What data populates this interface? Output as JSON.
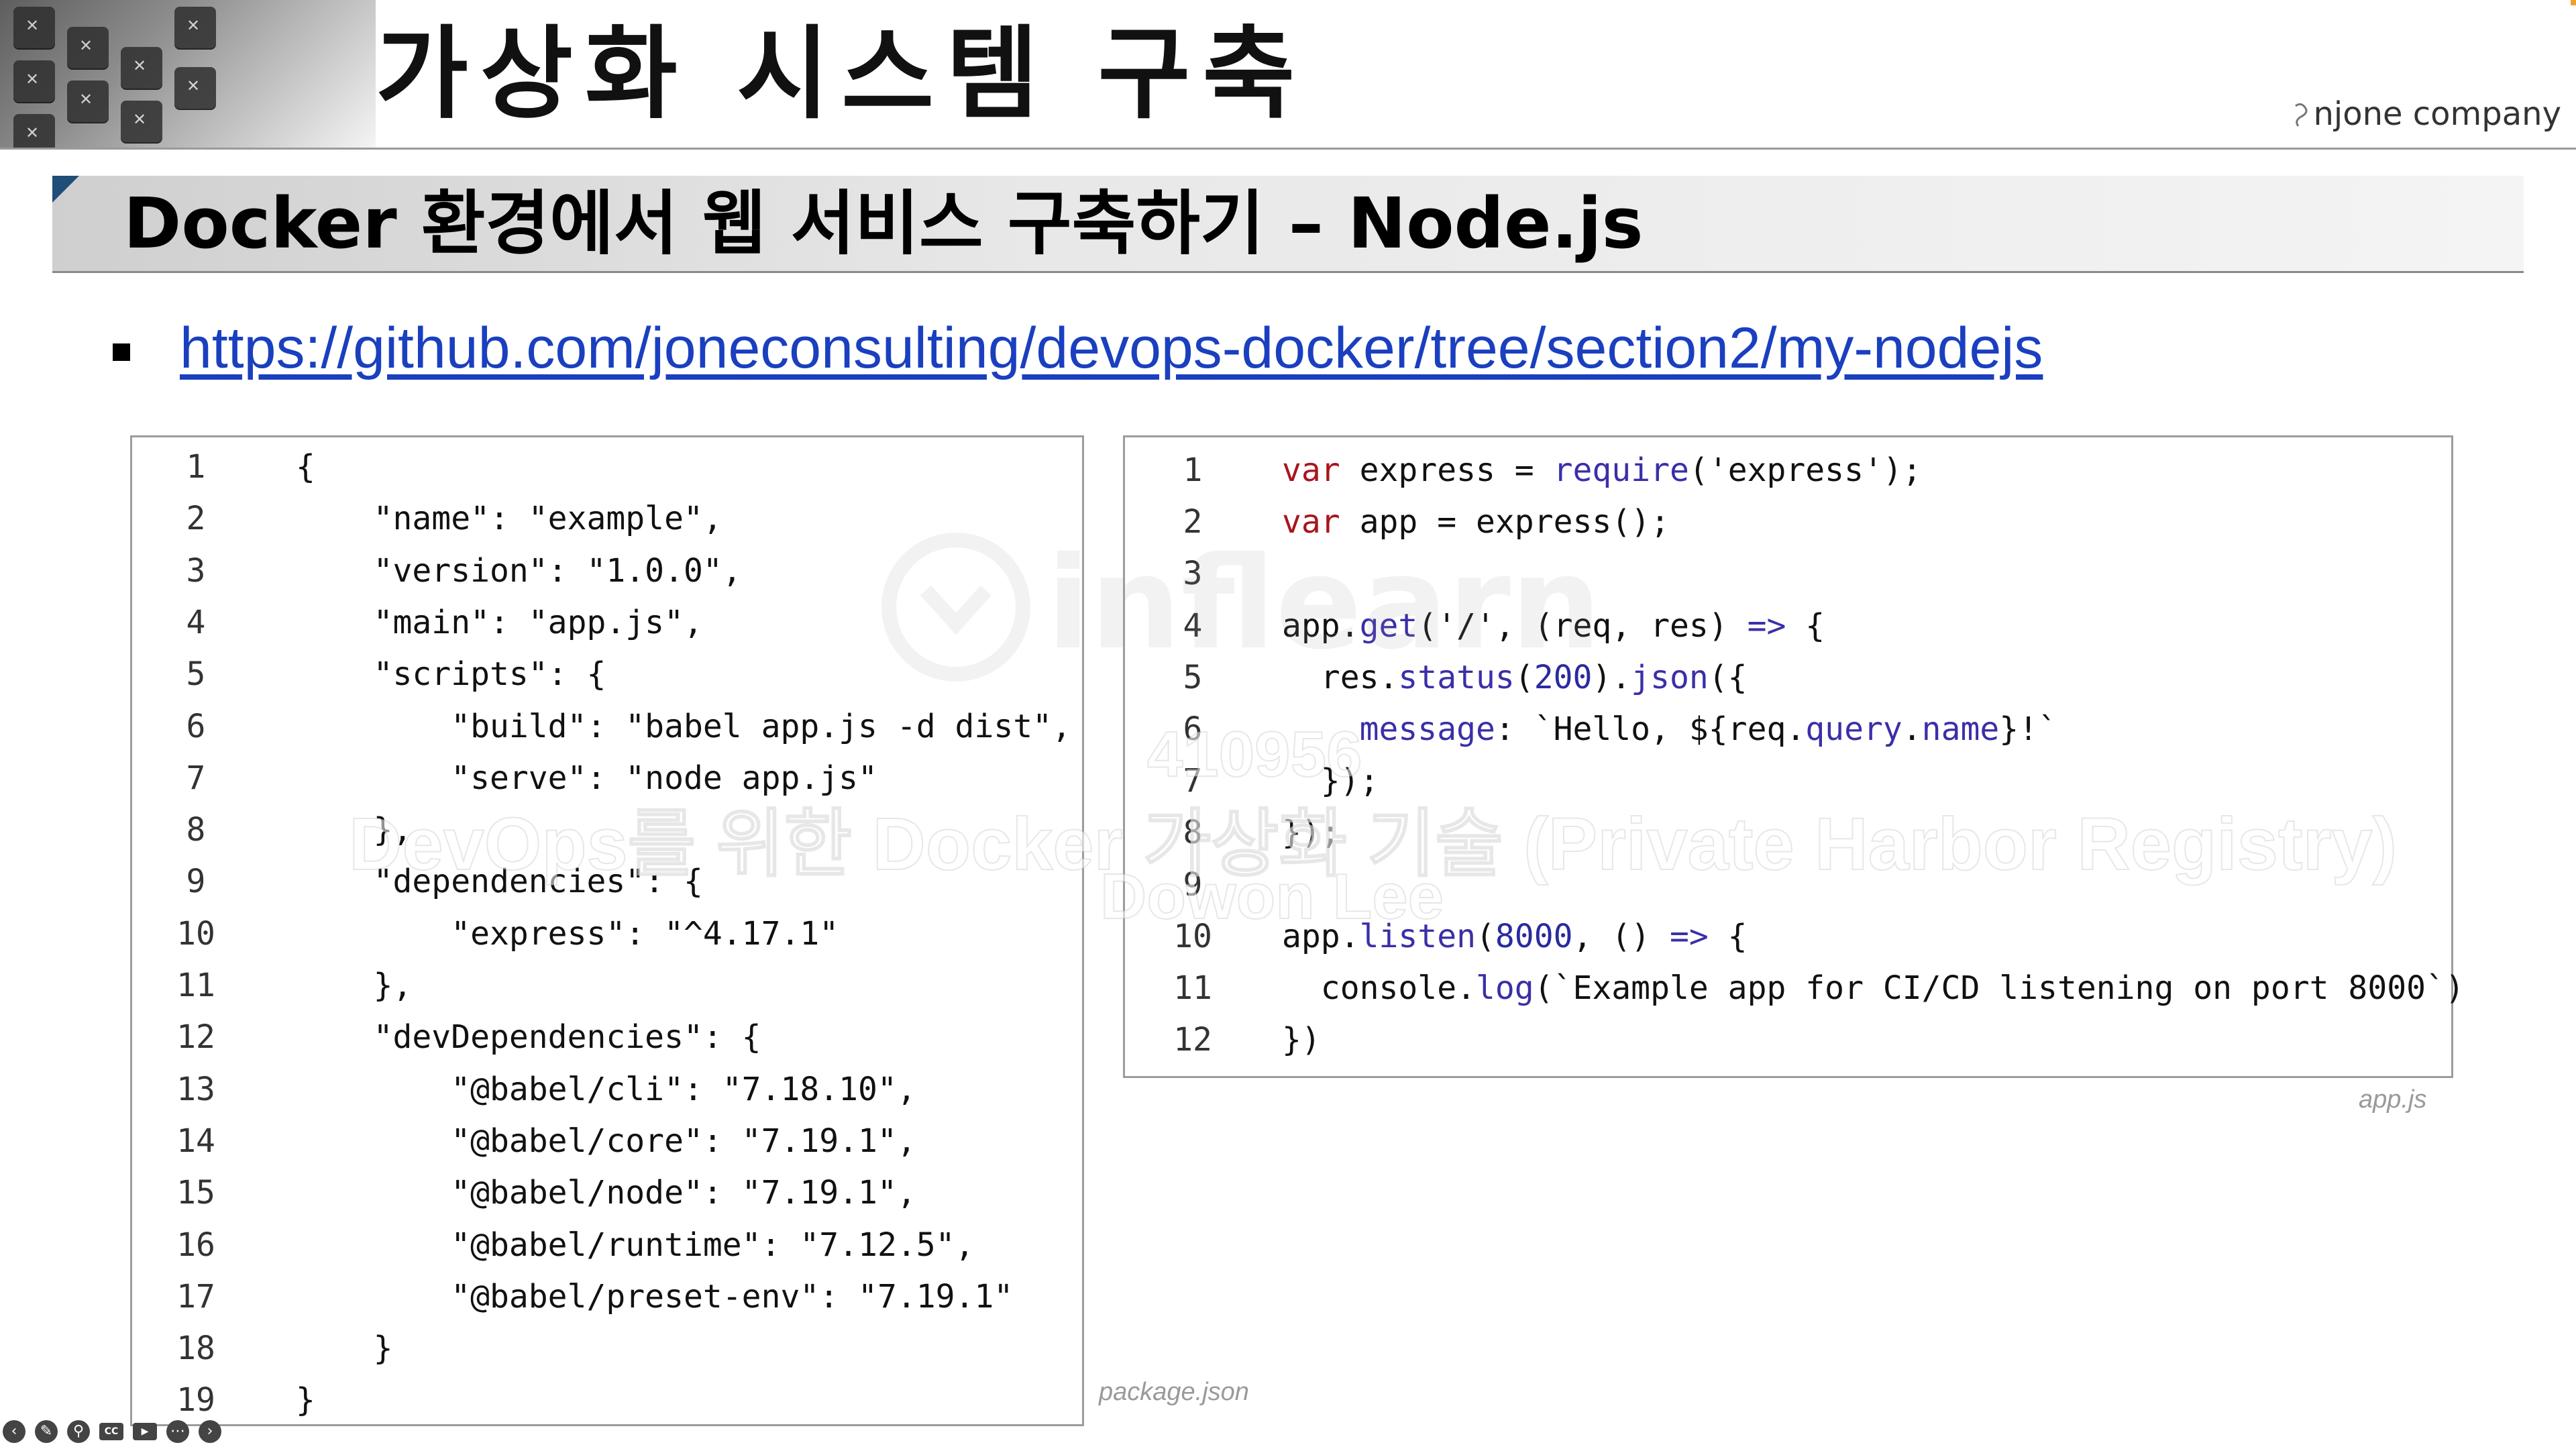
{
  "header": {
    "title": "가상화 시스템 구축",
    "brand": "njone company"
  },
  "subtitle": "Docker 환경에서 웹 서비스 구축하기 – Node.js",
  "repo_link": "https://github.com/joneconsulting/devops-docker/tree/section2/my-nodejs",
  "package_json": {
    "caption": "package.json",
    "lines": [
      {
        "n": "1",
        "code": "{"
      },
      {
        "n": "2",
        "code": "    \"name\": \"example\","
      },
      {
        "n": "3",
        "code": "    \"version\": \"1.0.0\","
      },
      {
        "n": "4",
        "code": "    \"main\": \"app.js\","
      },
      {
        "n": "5",
        "code": "    \"scripts\": {"
      },
      {
        "n": "6",
        "code": "        \"build\": \"babel app.js -d dist\","
      },
      {
        "n": "7",
        "code": "        \"serve\": \"node app.js\""
      },
      {
        "n": "8",
        "code": "    },"
      },
      {
        "n": "9",
        "code": "    \"dependencies\": {"
      },
      {
        "n": "10",
        "code": "        \"express\": \"^4.17.1\""
      },
      {
        "n": "11",
        "code": "    },"
      },
      {
        "n": "12",
        "code": "    \"devDependencies\": {"
      },
      {
        "n": "13",
        "code": "        \"@babel/cli\": \"7.18.10\","
      },
      {
        "n": "14",
        "code": "        \"@babel/core\": \"7.19.1\","
      },
      {
        "n": "15",
        "code": "        \"@babel/node\": \"7.19.1\","
      },
      {
        "n": "16",
        "code": "        \"@babel/runtime\": \"7.12.5\","
      },
      {
        "n": "17",
        "code": "        \"@babel/preset-env\": \"7.19.1\""
      },
      {
        "n": "18",
        "code": "    }"
      },
      {
        "n": "19",
        "code": "}"
      }
    ]
  },
  "app_js": {
    "caption": "app.js",
    "lines": [
      {
        "n": "1",
        "code": "var express = require('express');"
      },
      {
        "n": "2",
        "code": "var app = express();"
      },
      {
        "n": "3",
        "code": ""
      },
      {
        "n": "4",
        "code": "app.get('/', (req, res) => {"
      },
      {
        "n": "5",
        "code": "  res.status(200).json({"
      },
      {
        "n": "6",
        "code": "    message: `Hello, ${req.query.name}!`"
      },
      {
        "n": "7",
        "code": "  });"
      },
      {
        "n": "8",
        "code": "});"
      },
      {
        "n": "9",
        "code": ""
      },
      {
        "n": "10",
        "code": "app.listen(8000, () => {"
      },
      {
        "n": "11",
        "code": "  console.log(`Example app for CI/CD listening on port 8000`)"
      },
      {
        "n": "12",
        "code": "})"
      }
    ]
  },
  "watermark": {
    "logo": "inflearn",
    "id": "410956",
    "course": "DevOps를 위한 Docker 가상화 기술 (Private Harbor Registry)",
    "author": "Dowon Lee"
  },
  "toolbar": {
    "buttons": [
      "back-icon",
      "pen-icon",
      "zoom-icon",
      "cc-icon",
      "camera-icon",
      "more-icon",
      "forward-icon"
    ]
  },
  "colors": {
    "keyword": "#a8161e",
    "function": "#3a2fa8",
    "link": "#1a3fbf",
    "subtitle_corner": "#1f4e79"
  }
}
